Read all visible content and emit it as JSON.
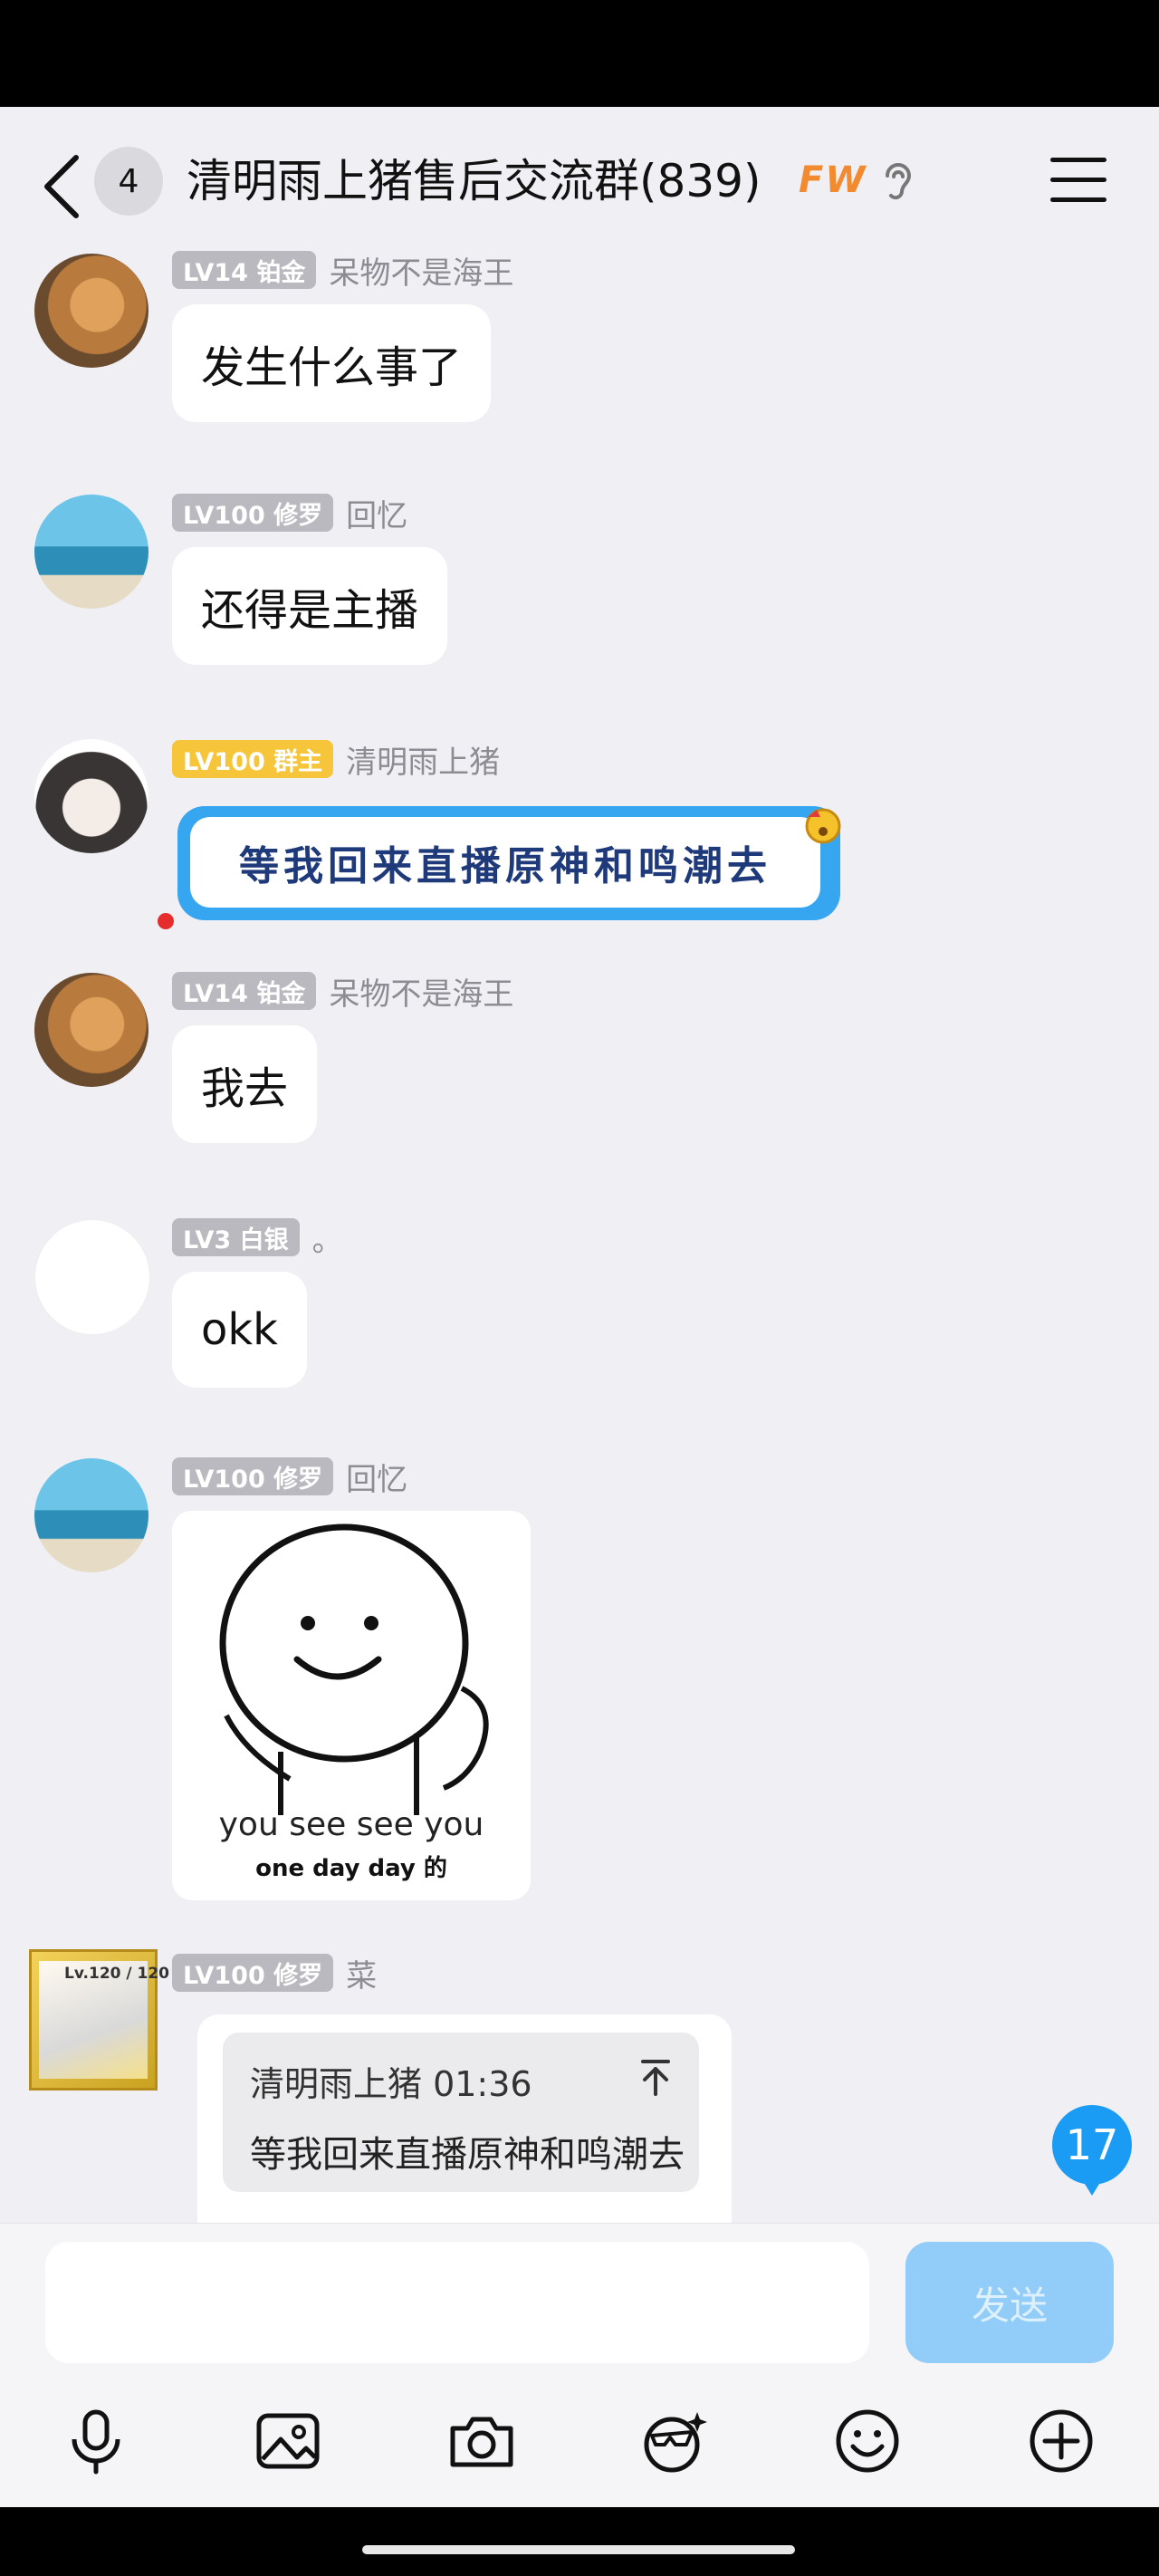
{
  "header": {
    "unread_count": "4",
    "title": "清明雨上猪售后交流群(839)",
    "tag": "FW"
  },
  "messages": [
    {
      "level": "LV14 铂金",
      "nickname": "呆物不是海王",
      "text": "发生什么事了"
    },
    {
      "level": "LV100 修罗",
      "nickname": "回忆",
      "text": "还得是主播"
    },
    {
      "level": "LV100 群主",
      "nickname": "清明雨上猪",
      "text": "等我回来直播原神和鸣潮去"
    },
    {
      "level": "LV14 铂金",
      "nickname": "呆物不是海王",
      "text": "我去"
    },
    {
      "level": "LV3 白银",
      "nickname": "。",
      "text": "okk"
    },
    {
      "level": "LV100 修罗",
      "nickname": "回忆",
      "sticker_line1": "you see see you",
      "sticker_line2": "one day day 的"
    },
    {
      "level": "LV100 修罗",
      "nickname": "菜",
      "avatar_text": "Lv.120 / 120",
      "quote_header": "清明雨上猪 01:36",
      "quote_text": "等我回来直播原神和鸣潮去"
    }
  ],
  "unread_bubble": "17",
  "input": {
    "send_label": "发送"
  },
  "toolbar": [
    "mic-icon",
    "image-icon",
    "camera-icon",
    "sticker-icon",
    "emoji-icon",
    "plus-icon"
  ]
}
